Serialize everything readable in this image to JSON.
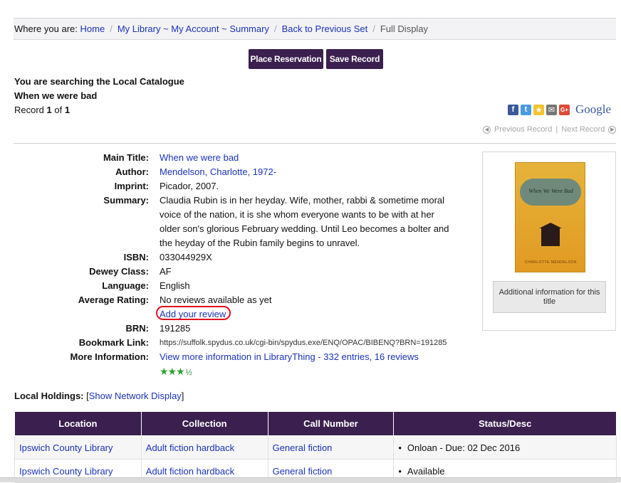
{
  "breadcrumb": {
    "prefix": "Where you are:",
    "items": [
      "Home",
      "My Library ~ My Account ~ Summary",
      "Back to Previous Set"
    ],
    "current": "Full Display",
    "separator": "/"
  },
  "actions": {
    "place_reservation": "Place Reservation",
    "save_record": "Save Record"
  },
  "search_info": {
    "catalogue": "You are searching the Local Catalogue",
    "query": "When we were bad",
    "record_prefix": "Record",
    "record_num": "1",
    "record_of": "of",
    "record_total": "1"
  },
  "share": {
    "facebook": "f",
    "twitter": "t",
    "favourite": "★",
    "email": "✉",
    "gplus": "G+",
    "google": "Google"
  },
  "nav": {
    "previous": "Previous Record",
    "divider": "|",
    "next": "Next Record"
  },
  "details": {
    "main_title": {
      "label": "Main Title:",
      "value": "When we were bad"
    },
    "author": {
      "label": "Author:",
      "value": "Mendelson, Charlotte, 1972-"
    },
    "imprint": {
      "label": "Imprint:",
      "value": "Picador, 2007."
    },
    "summary": {
      "label": "Summary:",
      "value": "Claudia Rubin is in her heyday. Wife, mother, rabbi & sometime moral voice of the nation, it is she whom everyone wants to be with at her older son's glorious February wedding. Until Leo becomes a bolter and the heyday of the Rubin family begins to unravel."
    },
    "isbn": {
      "label": "ISBN:",
      "value": "033044929X"
    },
    "dewey": {
      "label": "Dewey Class:",
      "value": "AF"
    },
    "language": {
      "label": "Language:",
      "value": "English"
    },
    "rating": {
      "label": "Average Rating:",
      "value": "No reviews available as yet",
      "add_review": "Add your review"
    },
    "brn": {
      "label": "BRN:",
      "value": "191285"
    },
    "bookmark": {
      "label": "Bookmark Link:",
      "value": "https://suffolk.spydus.co.uk/cgi-bin/spydus.exe/ENQ/OPAC/BIBENQ?BRN=191285"
    },
    "more_info": {
      "label": "More Information:",
      "value": "View more information in LibraryThing - 332 entries, 16 reviews",
      "stars": "★★★",
      "half": "½",
      "star_rating": 3.5
    }
  },
  "cover": {
    "title": "When We Were Bad",
    "author": "CHARLOTTE MENDELSON",
    "additional_info": "Additional information for this title"
  },
  "holdings": {
    "label": "Local Holdings:",
    "network_link": "Show Network Display",
    "open_bracket": "[",
    "close_bracket": "]",
    "columns": [
      "Location",
      "Collection",
      "Call Number",
      "Status/Desc"
    ],
    "rows": [
      [
        "Ipswich County Library",
        "Adult fiction hardback",
        "General fiction",
        "Onloan - Due: 02 Dec 2016"
      ],
      [
        "Ipswich County Library",
        "Adult fiction hardback",
        "General fiction",
        "Available"
      ]
    ]
  },
  "colors": {
    "accent": "#3b1f4e",
    "link": "#1a33b8",
    "highlight_ring": "#e0101c"
  }
}
